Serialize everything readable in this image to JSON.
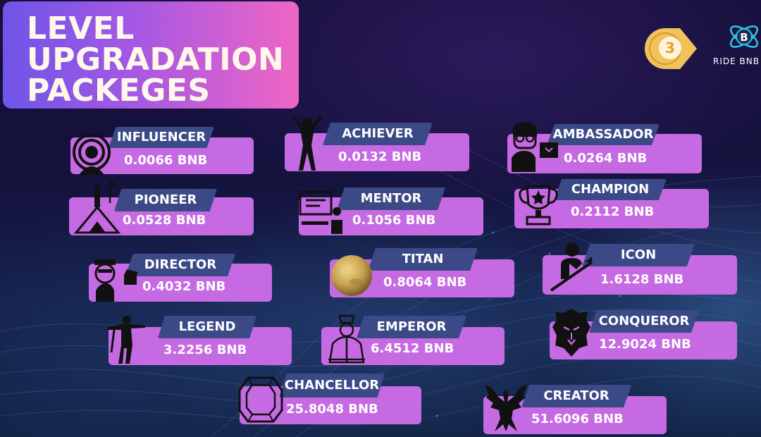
{
  "title": {
    "line1": "LEVEL",
    "line2": "UPGRADATION",
    "line3": "PACKEGES"
  },
  "page_badge": "3",
  "brand": {
    "name": "RIDE BNB",
    "letter": "B"
  },
  "packages": [
    {
      "name": "INFLUENCER",
      "price": "0.0066 BNB",
      "icon": "influencer-broadcast-icon"
    },
    {
      "name": "ACHIEVER",
      "price": "0.0132 BNB",
      "icon": "achiever-figure-icon"
    },
    {
      "name": "AMBASSADOR",
      "price": "0.0264 BNB",
      "icon": "ambassador-person-icon"
    },
    {
      "name": "PIONEER",
      "price": "0.0528 BNB",
      "icon": "pioneer-flag-mountain-icon"
    },
    {
      "name": "MENTOR",
      "price": "0.1056 BNB",
      "icon": "mentor-presentation-icon"
    },
    {
      "name": "CHAMPION",
      "price": "0.2112 BNB",
      "icon": "champion-trophy-icon"
    },
    {
      "name": "DIRECTOR",
      "price": "0.4032  BNB",
      "icon": "director-clapper-icon"
    },
    {
      "name": "TITAN",
      "price": "0.8064  BNB",
      "icon": "titan-planet-icon"
    },
    {
      "name": "ICON",
      "price": "1.6128  BNB",
      "icon": "icon-growth-arrow-icon"
    },
    {
      "name": "LEGEND",
      "price": "3.2256  BNB",
      "icon": "legend-warrior-icon"
    },
    {
      "name": "EMPEROR",
      "price": "6.4512  BNB",
      "icon": "emperor-crown-icon"
    },
    {
      "name": "CONQUEROR",
      "price": "12.9024  BNB",
      "icon": "conqueror-lion-icon"
    },
    {
      "name": "CHANCELLOR",
      "price": "25.8048 BNB",
      "icon": "chancellor-gem-icon"
    },
    {
      "name": "CREATOR",
      "price": "51.6096  BNB",
      "icon": "creator-phoenix-icon"
    }
  ],
  "colors": {
    "card_body": "#c56ae2",
    "card_tab": "#3b4a86",
    "title_gradient_start": "#6e55e8",
    "title_gradient_end": "#ef66c4",
    "badge": "#f2c25a"
  }
}
